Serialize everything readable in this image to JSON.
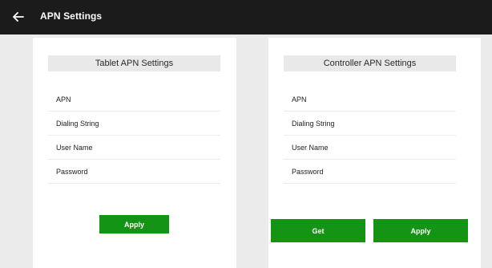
{
  "header": {
    "title": "APN Settings",
    "back_icon": "arrow-left-icon"
  },
  "colors": {
    "header_bg": "#1b1b1b",
    "page_bg": "#ebebeb",
    "card_bg": "#ffffff",
    "title_bar_bg": "#e9e9e9",
    "button_green": "#149414"
  },
  "tablet": {
    "title": "Tablet APN Settings",
    "fields": [
      "APN",
      "Dialing String",
      "User Name",
      "Password"
    ],
    "apply_label": "Apply"
  },
  "controller": {
    "title": "Controller APN Settings",
    "fields": [
      "APN",
      "Dialing String",
      "User Name",
      "Password"
    ],
    "get_label": "Get",
    "apply_label": "Apply"
  }
}
